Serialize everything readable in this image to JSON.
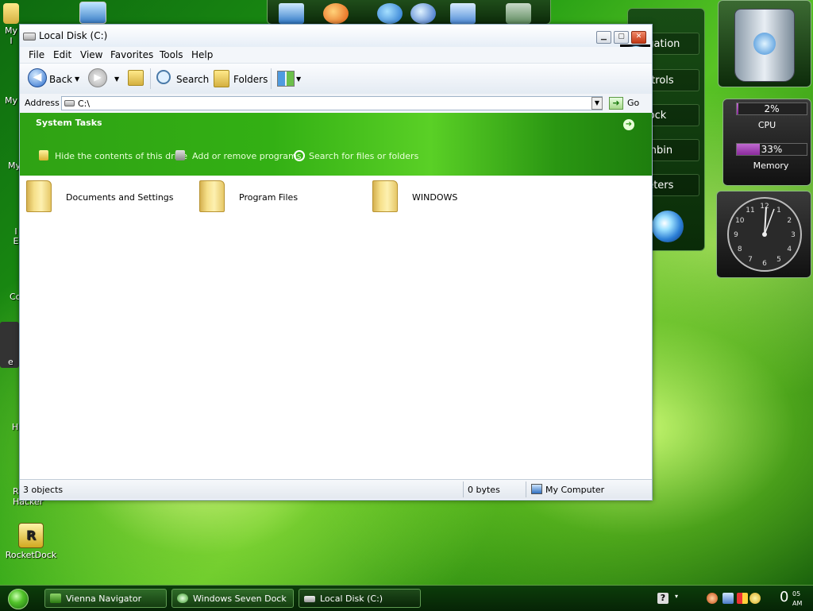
{
  "desktop": {
    "icons": [
      {
        "label": "My I"
      },
      {
        "label": "My"
      },
      {
        "label": "My"
      },
      {
        "label": "I E"
      },
      {
        "label": "Co"
      },
      {
        "label": "e"
      },
      {
        "label": "H"
      },
      {
        "label": "R Hacker"
      },
      {
        "label": "RocketDock"
      }
    ]
  },
  "sidebar": {
    "items": [
      "vigation",
      "ontrols",
      "Clock",
      "ashbin",
      "Meters"
    ],
    "cpu": {
      "value": "2%",
      "label": "CPU",
      "percent": 2
    },
    "memory": {
      "value": "33%",
      "label": "Memory",
      "percent": 33
    },
    "clock_numbers": [
      "12",
      "1",
      "2",
      "3",
      "4",
      "5",
      "6",
      "7",
      "8",
      "9",
      "10",
      "11"
    ]
  },
  "window": {
    "title": "Local Disk (C:)",
    "menu": [
      {
        "key": "F",
        "rest": "ile"
      },
      {
        "key": "E",
        "rest": "dit"
      },
      {
        "key": "V",
        "rest": "iew"
      },
      {
        "key": "F",
        "rest": "a"
      },
      {
        "key": "T",
        "rest": "ools"
      },
      {
        "key": "H",
        "rest": "elp"
      }
    ],
    "menu_full": [
      "File",
      "Edit",
      "View",
      "Favorites",
      "Tools",
      "Help"
    ],
    "toolbar": {
      "back": "Back",
      "search": "Search",
      "folders": "Folders"
    },
    "address": {
      "label": "Address",
      "value": "C:\\",
      "go": "Go"
    },
    "tasks": {
      "title": "System Tasks",
      "links": [
        "Hide the contents of this drive",
        "Add or remove programs",
        "Search for files or folders"
      ]
    },
    "folders": [
      "Documents and Settings",
      "Program Files",
      "WINDOWS"
    ],
    "status": {
      "objects": "3 objects",
      "size": "0 bytes",
      "location": "My Computer"
    }
  },
  "taskbar": {
    "buttons": [
      "Vienna Navigator",
      "Windows Seven Dock",
      "Local Disk (C:)"
    ],
    "clock": {
      "hour": "0",
      "minute": "05",
      "ampm": "AM"
    }
  },
  "colors": {
    "desktop_green": "#2b8a10",
    "tasks_green": "#33b014",
    "close_red": "#c23612",
    "taskbar": "#0c3d0a"
  }
}
